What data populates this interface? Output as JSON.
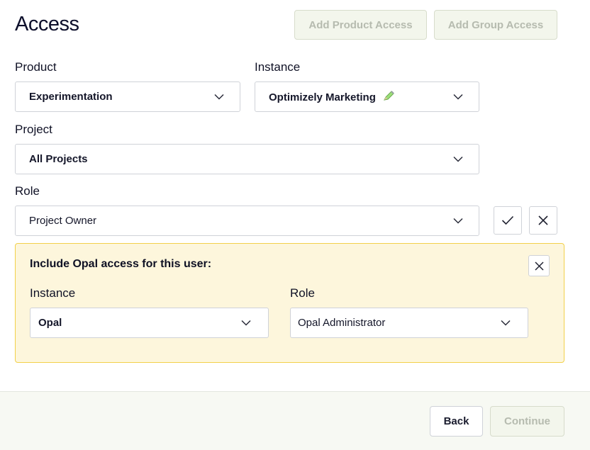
{
  "header": {
    "title": "Access",
    "add_product_label": "Add Product Access",
    "add_group_label": "Add Group Access"
  },
  "form": {
    "product": {
      "label": "Product",
      "value": "Experimentation"
    },
    "instance": {
      "label": "Instance",
      "value": "Optimizely Marketing",
      "icon": "pencil-icon"
    },
    "project": {
      "label": "Project",
      "value": "All Projects"
    },
    "role": {
      "label": "Role",
      "value": "Project Owner"
    }
  },
  "opal": {
    "title": "Include Opal access for this user:",
    "instance": {
      "label": "Instance",
      "value": "Opal"
    },
    "role": {
      "label": "Role",
      "value": "Opal Administrator"
    }
  },
  "footer": {
    "back_label": "Back",
    "continue_label": "Continue"
  },
  "colors": {
    "disabled_bg": "#f3f6ec",
    "disabled_text": "#b6bbaf",
    "opal_bg": "#fdf6dc",
    "opal_border": "#f2d04a",
    "border": "#cfd2d8"
  }
}
